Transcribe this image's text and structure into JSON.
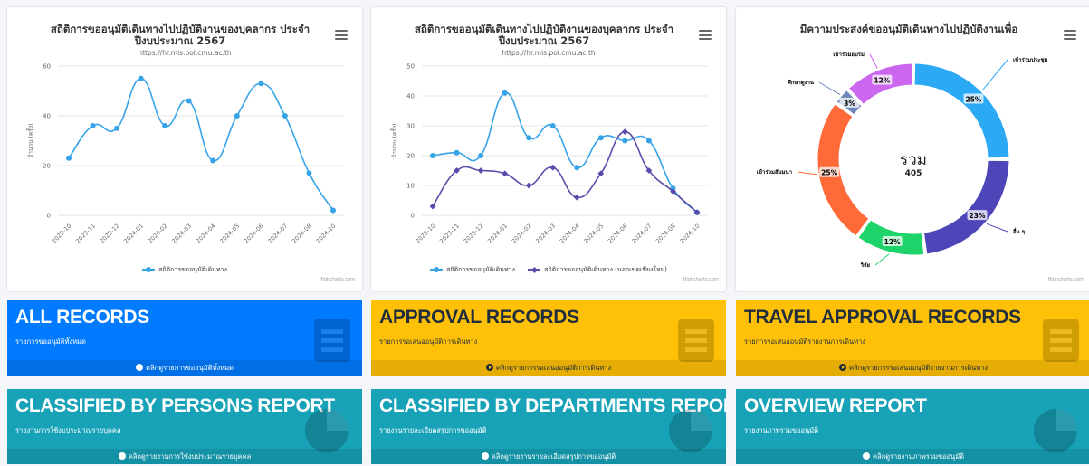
{
  "charts": {
    "line1": {
      "title": "สถิติการขออนุมัติเดินทางไปปฏิบัติงานของบุคลากร ประจำปีงบประมาณ 2567",
      "subtitle": "https://hr.mis.pol.cmu.ac.th",
      "credits": "Highcharts.com",
      "ylabel": "จำนวน (ครั้ง)"
    },
    "line2": {
      "title": "สถิติการขออนุมัติเดินทางไปปฏิบัติงานของบุคลากร ประจำปีงบประมาณ 2567",
      "subtitle": "https://hr.mis.pol.cmu.ac.th",
      "credits": "Highcharts.com",
      "ylabel": "จำนวน (ครั้ง)"
    },
    "donut": {
      "title": "มีความประสงค์ขออนุมัติเดินทางไปปฏิบัติงานเพื่อ",
      "credits": "Highcharts.com",
      "center_label": "รวม",
      "center_value": "405"
    }
  },
  "chart_data": [
    {
      "type": "line",
      "title": "สถิติการขออนุมัติเดินทางไปปฏิบัติงานของบุคลากร ประจำปีงบประมาณ 2567",
      "subtitle": "https://hr.mis.pol.cmu.ac.th",
      "ylabel": "จำนวน (ครั้ง)",
      "categories": [
        "2023-10",
        "2023-11",
        "2023-12",
        "2024-01",
        "2024-02",
        "2024-03",
        "2024-04",
        "2024-05",
        "2024-06",
        "2024-07",
        "2024-08",
        "2024-10"
      ],
      "ylim": [
        0,
        60
      ],
      "yticks": [
        0,
        20,
        40,
        60
      ],
      "series": [
        {
          "name": "สถิติการขออนุมัติเดินทาง",
          "color": "#36a3e8",
          "marker": "circle",
          "values": [
            23,
            36,
            35,
            55,
            36,
            46,
            22,
            40,
            53,
            40,
            17,
            2
          ]
        }
      ],
      "legend": "bottom-center"
    },
    {
      "type": "line",
      "title": "สถิติการขออนุมัติเดินทางไปปฏิบัติงานของบุคลากร ประจำปีงบประมาณ 2567",
      "subtitle": "https://hr.mis.pol.cmu.ac.th",
      "ylabel": "จำนวน (ครั้ง)",
      "categories": [
        "2023-10",
        "2023-11",
        "2023-12",
        "2024-01",
        "2024-02",
        "2024-03",
        "2024-04",
        "2024-05",
        "2024-06",
        "2024-07",
        "2024-08",
        "2024-10"
      ],
      "ylim": [
        0,
        50
      ],
      "yticks": [
        0,
        10,
        20,
        30,
        40,
        50
      ],
      "series": [
        {
          "name": "สถิติการขออนุมัติเดินทาง",
          "color": "#36a3e8",
          "marker": "circle",
          "values": [
            20,
            21,
            20,
            41,
            26,
            30,
            16,
            26,
            25,
            25,
            9,
            1
          ]
        },
        {
          "name": "สถิติการขออนุมัติเดินทาง (นอกเขตเชียงใหม่)",
          "color": "#5b4bab",
          "marker": "diamond",
          "values": [
            3,
            15,
            15,
            14,
            10,
            16,
            6,
            14,
            28,
            15,
            8,
            1
          ]
        }
      ],
      "legend": "bottom-center"
    },
    {
      "type": "pie",
      "title": "มีความประสงค์ขออนุมัติเดินทางไปปฏิบัติงานเพื่อ",
      "total_label": "รวม",
      "total": 405,
      "slices": [
        {
          "name": "เข้าร่วมประชุม",
          "percent": 25,
          "color": "#2ba9f5"
        },
        {
          "name": "อื่น ๆ",
          "percent": 23,
          "color": "#4e46b8"
        },
        {
          "name": "วิจัย",
          "percent": 12,
          "color": "#1ed46a"
        },
        {
          "name": "เข้าร่วมสัมมนา",
          "percent": 25,
          "color": "#ff6a38"
        },
        {
          "name": "ศึกษาดูงาน",
          "percent": 3,
          "color": "#6d88b8"
        },
        {
          "name": "เข้าร่วมอบรม",
          "percent": 12,
          "color": "#cc66ee"
        }
      ]
    }
  ],
  "boxes": [
    {
      "title": "ALL RECORDS",
      "desc": "รายการขออนุมัติทั้งหมด",
      "link": "คลิกดูรายการขออนุมัติทั้งหมด",
      "color": "blue",
      "icon": "list-icon"
    },
    {
      "title": "APPROVAL RECORDS",
      "desc": "รายการรอเสนออนุมัติการเดินทาง",
      "link": "คลิกดูรายการรอเสนออนุมัติการเดินทาง",
      "color": "yellow",
      "icon": "list-icon"
    },
    {
      "title": "TRAVEL APPROVAL RECORDS",
      "desc": "รายการรอเสนออนุมัติรายงานการเดินทาง",
      "link": "คลิกดูรายการรอเสนออนุมัติรายงานการเดินทาง",
      "color": "yellow",
      "icon": "list-icon"
    },
    {
      "title": "CLASSIFIED BY PERSONS REPORT",
      "desc": "รายงานการใช้งบประมาณรายบุคคล",
      "link": "คลิกดูรายงานการใช้งบประมาณรายบุคคล",
      "color": "teal",
      "icon": "pie-chart-icon"
    },
    {
      "title": "CLASSIFIED BY DEPARTMENTS REPORT",
      "desc": "รายงานรายละเอียดสรุปการขออนุมัติ",
      "link": "คลิกดูรายงานรายละเอียดสรุปการขออนุมัติ",
      "color": "teal",
      "icon": "pie-chart-icon"
    },
    {
      "title": "OVERVIEW REPORT",
      "desc": "รายงานภาพรวมขออนุมัติ",
      "link": "คลิกดูรายงานภาพรวมขออนุมัติ",
      "color": "teal",
      "icon": "pie-chart-icon"
    }
  ]
}
